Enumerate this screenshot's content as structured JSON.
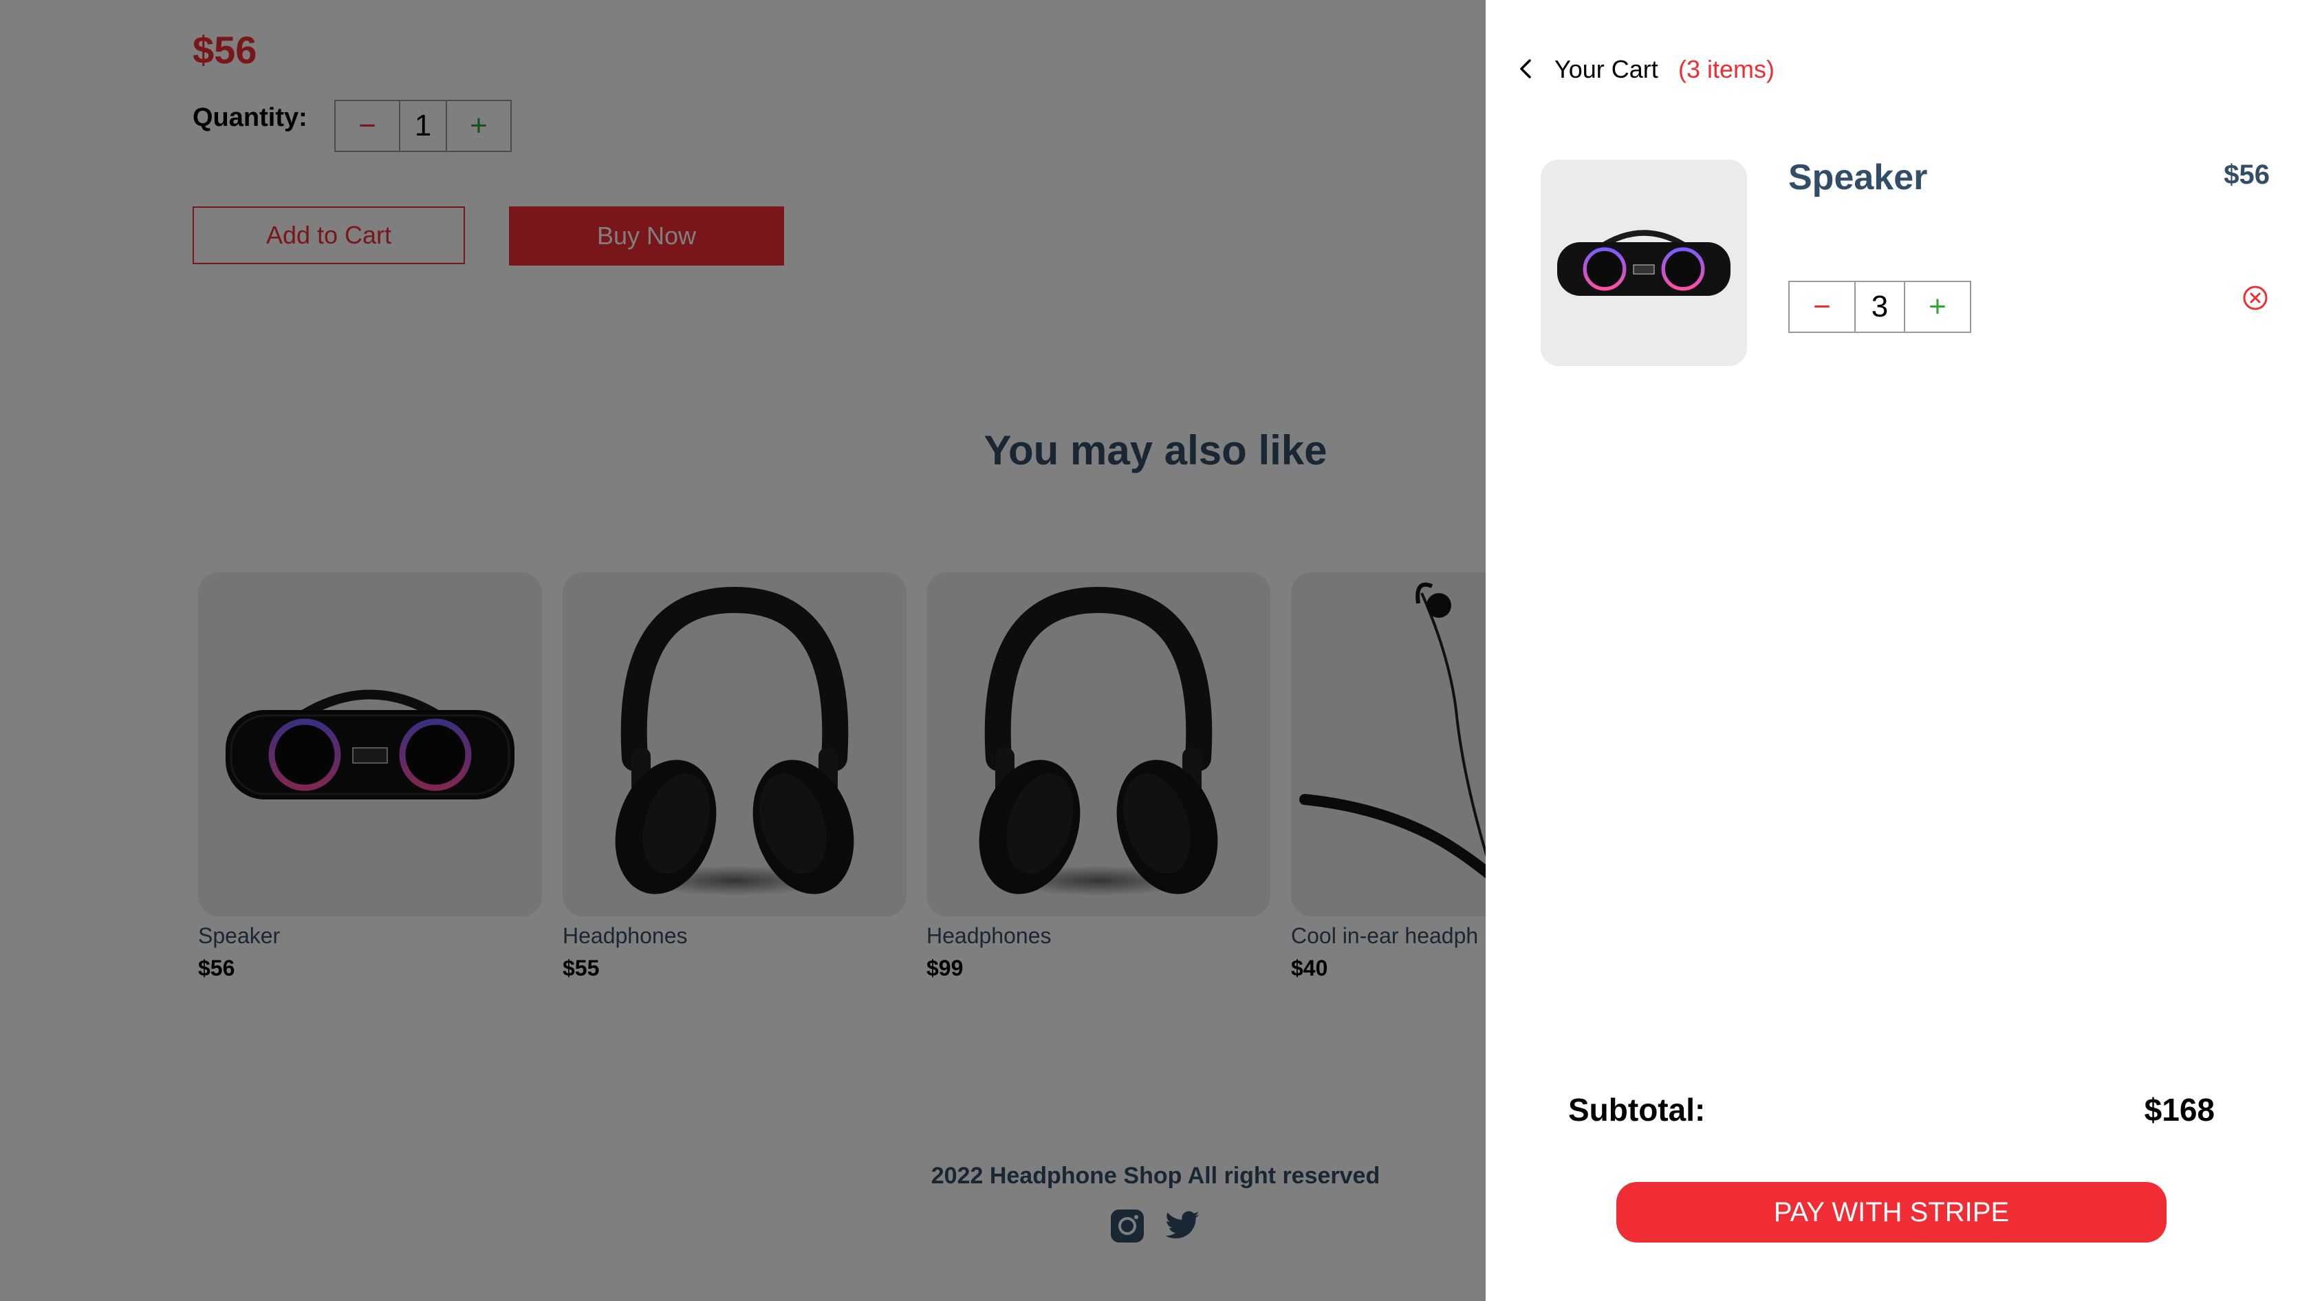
{
  "product": {
    "price": "$56",
    "quantity_label": "Quantity:",
    "quantity": "1",
    "minus": "−",
    "plus": "+",
    "add_to_cart": "Add to Cart",
    "buy_now": "Buy Now"
  },
  "related": {
    "heading": "You may also like",
    "items": [
      {
        "name": "Speaker",
        "price": "$56",
        "icon": "speaker-image"
      },
      {
        "name": "Headphones",
        "price": "$55",
        "icon": "headphones-image"
      },
      {
        "name": "Headphones",
        "price": "$99",
        "icon": "headphones-image"
      },
      {
        "name": "Cool in-ear headph",
        "price": "$40",
        "icon": "earphones-image"
      }
    ]
  },
  "footer": {
    "text": "2022 Headphone Shop All right reserved",
    "icons": [
      "instagram-icon",
      "twitter-icon"
    ]
  },
  "cart": {
    "title": "Your Cart",
    "count": "(3 items)",
    "item": {
      "name": "Speaker",
      "price": "$56",
      "quantity": "3",
      "minus": "−",
      "plus": "+"
    },
    "subtotal_label": "Subtotal:",
    "subtotal_value": "$168",
    "pay_button": "PAY WITH STRIPE"
  },
  "colors": {
    "accent": "#f02d34",
    "text": "#324d67",
    "plus": "#31a831",
    "card_bg": "#ebebeb"
  }
}
